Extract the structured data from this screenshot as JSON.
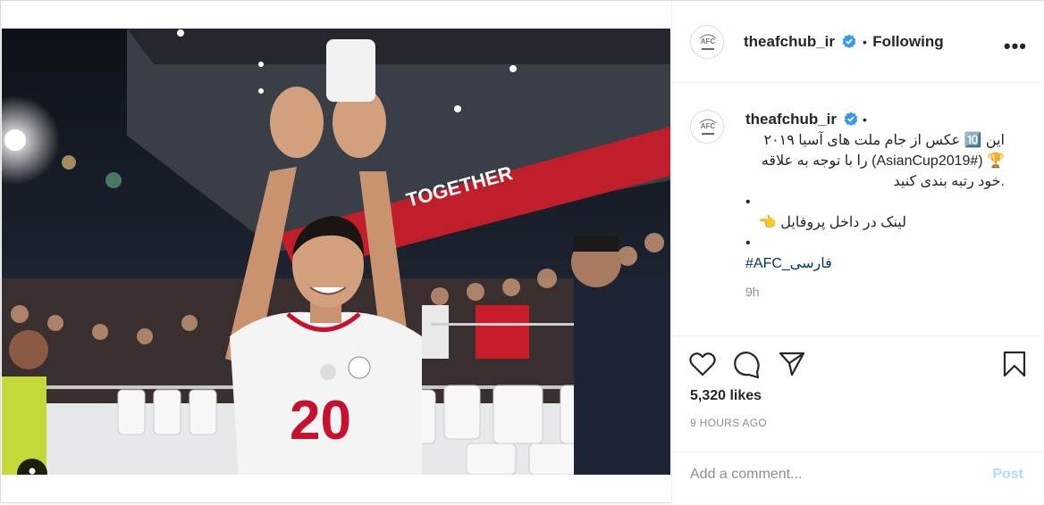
{
  "post": {
    "username": "theafchub_ir",
    "separator": "•",
    "follow_status": "Following",
    "more": "•••",
    "avatar_label": "AFC",
    "caption_lines": [
      "این 🔟 عکس از جام ملت های آسیا ۲۰۱۹",
      "🏆 (#AsianCup2019) را با توجه به علاقه",
      ".خود رتبه بندی کنید",
      "•",
      "لینک در داخل پروفایل 👈",
      "•"
    ],
    "hashtag": "#AFC_فارسی",
    "relative_time": "9h",
    "likes": "5,320 likes",
    "posted_ago": "9 HOURS AGO",
    "comment_placeholder": "Add a comment...",
    "post_label": "Post"
  },
  "photo": {
    "banner_text": "TOGETHER",
    "jersey_number": "20",
    "carousel_count": 10,
    "carousel_active_index": 0
  },
  "colors": {
    "verified": "#3897f0",
    "hashtag": "#00376b",
    "post_disabled": "#b3dbff",
    "jersey_red": "#c8102e"
  }
}
